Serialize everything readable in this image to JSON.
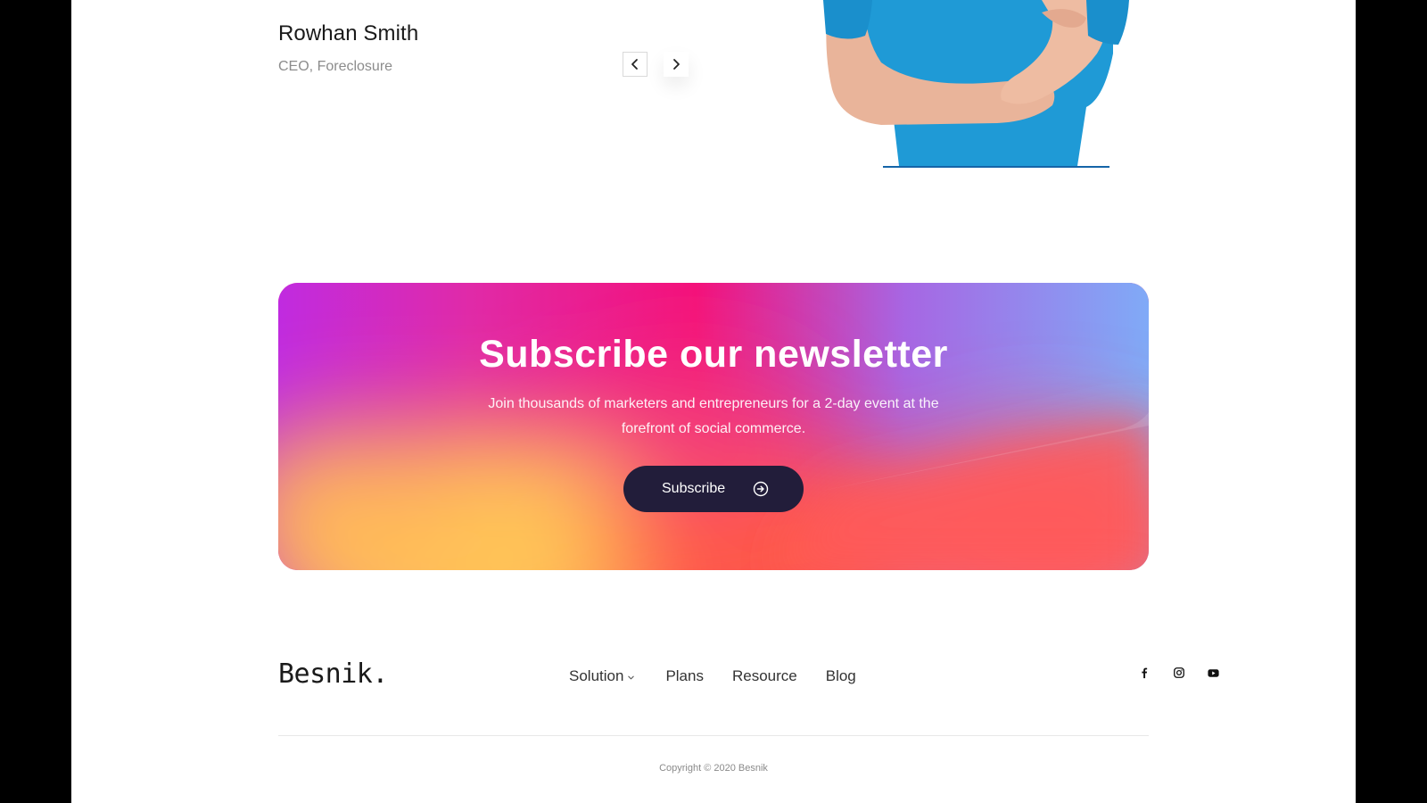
{
  "testimonial": {
    "name": "Rowhan Smith",
    "role": "CEO, Foreclosure",
    "prev_icon": "chevron-left-icon",
    "next_icon": "chevron-right-icon"
  },
  "newsletter": {
    "title": "Subscribe our newsletter",
    "description": "Join thousands of marketers and entrepreneurs for a 2-day event at the forefront of social commerce.",
    "button_label": "Subscribe",
    "button_icon": "arrow-right-circle-icon"
  },
  "footer": {
    "brand": "Besnik.",
    "nav": [
      {
        "label": "Solution",
        "has_dropdown": true
      },
      {
        "label": "Plans"
      },
      {
        "label": "Resource"
      },
      {
        "label": "Blog"
      }
    ],
    "social": [
      "facebook-icon",
      "instagram-icon",
      "youtube-icon"
    ],
    "copyright": "Copyright © 2020 Besnik"
  },
  "colors": {
    "button_dark": "#221d3a",
    "portrait_underline": "#1565a8",
    "shirt": "#1f9ad6"
  }
}
